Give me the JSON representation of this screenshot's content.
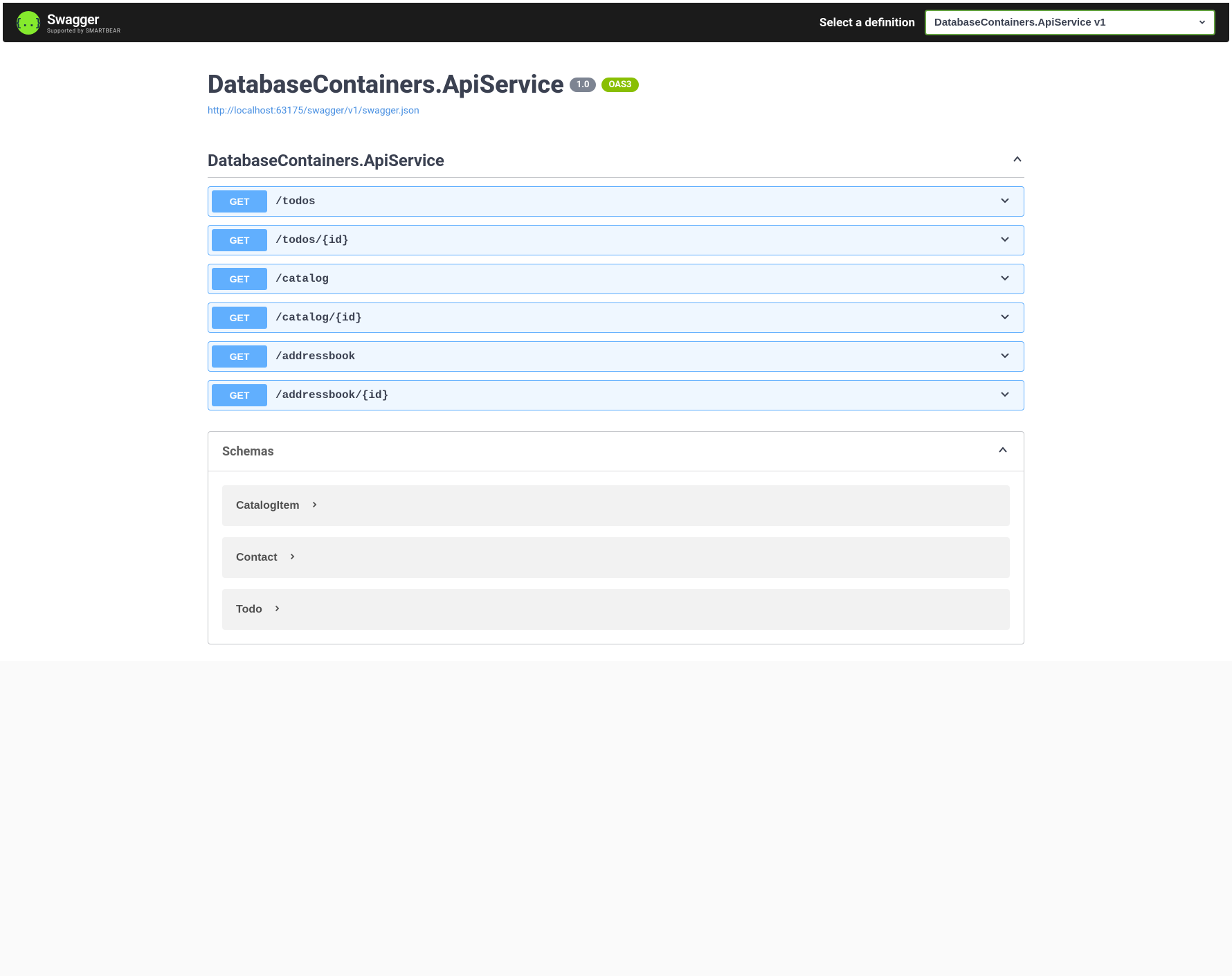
{
  "topbar": {
    "logo_main": "Swagger",
    "logo_sub": "Supported by SMARTBEAR",
    "select_label": "Select a definition",
    "selected_definition": "DatabaseContainers.ApiService v1"
  },
  "info": {
    "title": "DatabaseContainers.ApiService",
    "version": "1.0",
    "oas": "OAS3",
    "spec_url": "http://localhost:63175/swagger/v1/swagger.json"
  },
  "tag": {
    "name": "DatabaseContainers.ApiService",
    "operations": [
      {
        "method": "GET",
        "path": "/todos"
      },
      {
        "method": "GET",
        "path": "/todos/{id}"
      },
      {
        "method": "GET",
        "path": "/catalog"
      },
      {
        "method": "GET",
        "path": "/catalog/{id}"
      },
      {
        "method": "GET",
        "path": "/addressbook"
      },
      {
        "method": "GET",
        "path": "/addressbook/{id}"
      }
    ]
  },
  "schemas": {
    "title": "Schemas",
    "items": [
      {
        "name": "CatalogItem"
      },
      {
        "name": "Contact"
      },
      {
        "name": "Todo"
      }
    ]
  },
  "colors": {
    "get_method": "#61affe",
    "accent_green": "#85ea2d",
    "select_border": "#62a03f"
  }
}
